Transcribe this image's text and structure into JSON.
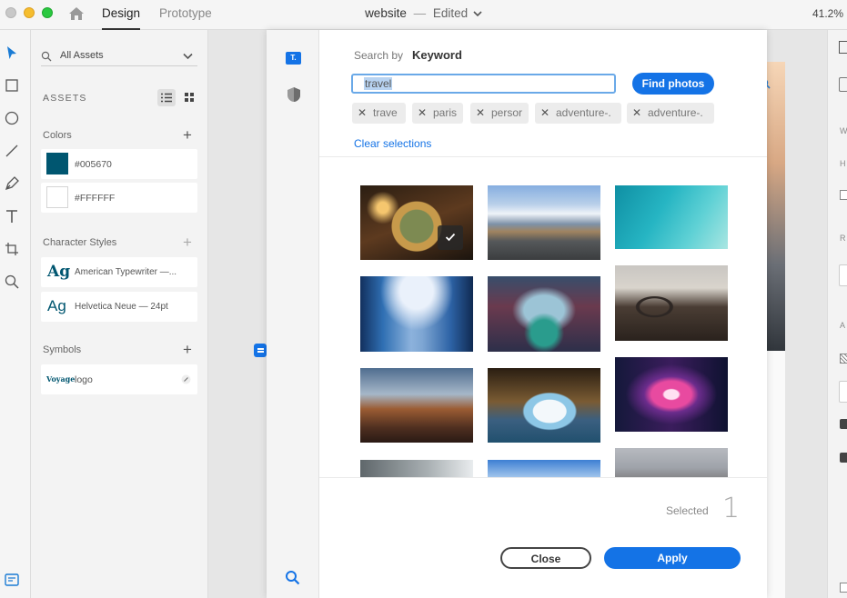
{
  "titlebar": {
    "tabs": [
      {
        "label": "Design"
      },
      {
        "label": "Prototype"
      }
    ],
    "document_name": "website",
    "separator": "—",
    "status": "Edited",
    "zoom": "41.2%"
  },
  "assets": {
    "filter_label": "All Assets",
    "header": "ASSETS",
    "colors_label": "Colors",
    "colors": [
      {
        "hex": "#005670"
      },
      {
        "hex": "#FFFFFF"
      }
    ],
    "character_styles_label": "Character Styles",
    "character_styles": [
      {
        "sample": "Ag",
        "name": "American Typewriter —..."
      },
      {
        "sample": "Ag",
        "name": "Helvetica Neue — 24pt"
      }
    ],
    "symbols_label": "Symbols",
    "symbols": [
      {
        "thumb": "Voyage",
        "name": "logo"
      }
    ]
  },
  "dialog": {
    "search_by_label": "Search by",
    "search_mode": "Keyword",
    "search_value": "travel",
    "find_button": "Find photos",
    "chips": [
      "trave",
      "paris",
      "persor",
      "adventure-.",
      "adventure-."
    ],
    "clear_link": "Clear selections",
    "selected_label": "Selected",
    "selected_count": "1",
    "close_button": "Close",
    "apply_button": "Apply"
  },
  "colors": {
    "accent": "#1473e6",
    "swatch_primary": "#005670"
  }
}
